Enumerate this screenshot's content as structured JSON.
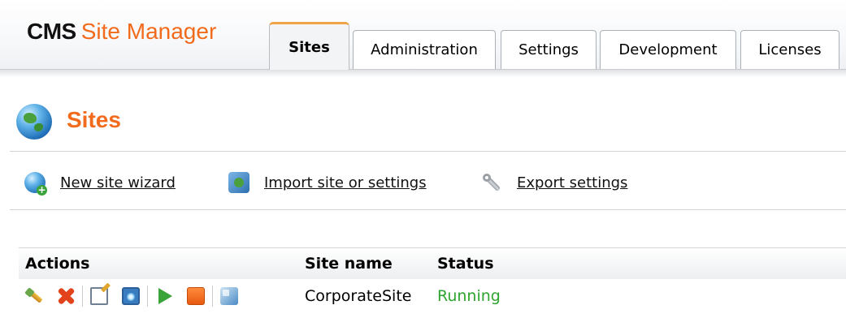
{
  "app": {
    "brand_bold": "CMS",
    "brand_rest": "Site Manager",
    "accent_color": "#f26a1b"
  },
  "tabs": [
    {
      "label": "Sites",
      "active": true
    },
    {
      "label": "Administration",
      "active": false
    },
    {
      "label": "Settings",
      "active": false
    },
    {
      "label": "Development",
      "active": false
    },
    {
      "label": "Licenses",
      "active": false
    }
  ],
  "page": {
    "title": "Sites",
    "title_icon": "globe-icon"
  },
  "actions": [
    {
      "label": "New site wizard",
      "icon": "globe-add-icon"
    },
    {
      "label": "Import site or settings",
      "icon": "import-icon"
    },
    {
      "label": "Export settings",
      "icon": "wrench-icon"
    }
  ],
  "grid": {
    "headers": {
      "actions": "Actions",
      "site_name": "Site name",
      "status": "Status"
    },
    "row_action_icons": [
      "edit-icon",
      "delete-icon",
      "edit-document-icon",
      "preview-icon",
      "start-icon",
      "stop-icon",
      "export-icon"
    ],
    "rows": [
      {
        "site_name": "CorporateSite",
        "status": "Running",
        "status_color": "#2ea52e"
      }
    ]
  }
}
